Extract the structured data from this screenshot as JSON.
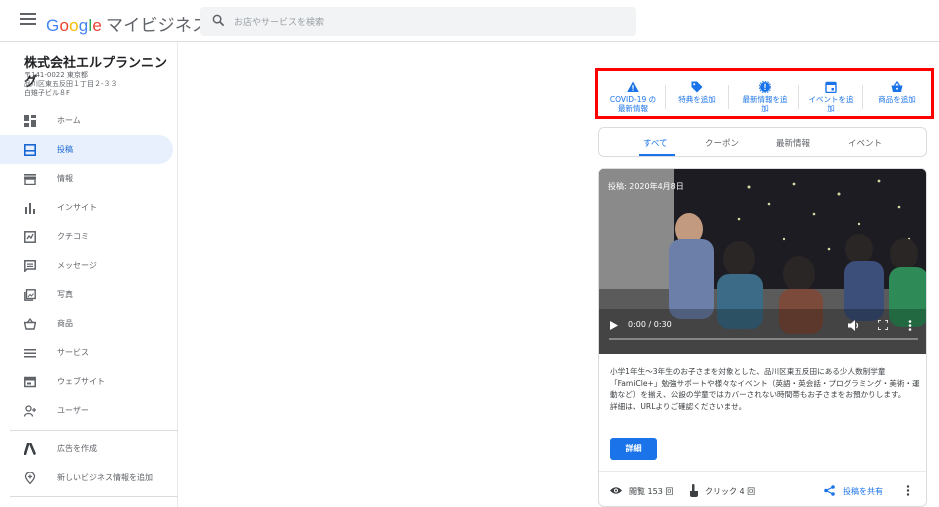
{
  "header": {
    "logo_letters": [
      "G",
      "o",
      "o",
      "g",
      "l",
      "e"
    ],
    "logo_rest": "マイビジネス",
    "search_placeholder": "お店やサービスを検索"
  },
  "business": {
    "name": "株式会社エルプランニング",
    "address": "〒141-0022 東京都\n品川区東五反田１丁目２-３３\n白雉子ビル８F"
  },
  "sidebar": {
    "items": [
      {
        "label": "ホーム",
        "icon": "dashboard-icon"
      },
      {
        "label": "投稿",
        "icon": "post-icon",
        "active": true
      },
      {
        "label": "情報",
        "icon": "storefront-icon"
      },
      {
        "label": "インサイト",
        "icon": "bar-chart-icon"
      },
      {
        "label": "クチコミ",
        "icon": "review-icon"
      },
      {
        "label": "メッセージ",
        "icon": "message-icon"
      },
      {
        "label": "写真",
        "icon": "photo-icon"
      },
      {
        "label": "商品",
        "icon": "basket-icon"
      },
      {
        "label": "サービス",
        "icon": "list-icon"
      },
      {
        "label": "ウェブサイト",
        "icon": "website-icon"
      },
      {
        "label": "ユーザー",
        "icon": "add-user-icon"
      }
    ],
    "bottom_items": [
      {
        "label": "広告を作成",
        "icon": "google-ads-icon"
      },
      {
        "label": "新しいビジネス情報を追加",
        "icon": "add-location-icon"
      }
    ]
  },
  "actions": {
    "covid": "COVID-19 の\n最新情報",
    "offer": "特典を追加",
    "update": "最新情報を追\n加",
    "event": "イベントを追\n加",
    "product": "商品を追加"
  },
  "tabs": [
    "すべて",
    "クーポン",
    "最新情報",
    "イベント"
  ],
  "post": {
    "date_label": "投稿: 2020年4月8日",
    "time": "0:00 / 0:30",
    "body": "小学1年生〜3年生のお子さまを対象とした、品川区東五反田にある少人数制学童「FamiCle+」勉強サポートや様々なイベント（英語・英会話・プログラミング・美術・運動など）を揃え、公設の学童ではカバーされない時間帯もお子さまをお預かりします。\n詳細は、URLよりご確認くださいませ。",
    "detail_button": "詳細",
    "views": "閲覧 153 回",
    "clicks": "クリック 4 回",
    "share": "投稿を共有"
  },
  "colors": {
    "accent": "#1a73e8",
    "highlight_border": "#ff0000",
    "active_nav_bg": "#e8f0fe"
  }
}
